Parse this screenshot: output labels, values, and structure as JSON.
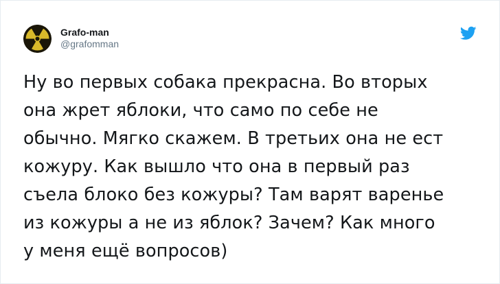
{
  "author": {
    "display_name": "Grafo-man",
    "handle": "@grafomman",
    "avatar_icon": "radiation-symbol-icon"
  },
  "brand": {
    "logo_icon": "twitter-bird-icon",
    "color": "#1da1f2"
  },
  "tweet": {
    "lines": [
      "Ну во первых собака прекрасна. Во вторых",
      "она жрет яблоки, что само по себе не",
      "обычно. Мягко скажем. В третьих она не ест",
      "кожуру. Как вышло что она в первый раз",
      "съела блоко без кожуры? Там варят варенье",
      "из кожуры а не из яблок? Зачем? Как много",
      "у меня ещё вопросов)"
    ]
  }
}
